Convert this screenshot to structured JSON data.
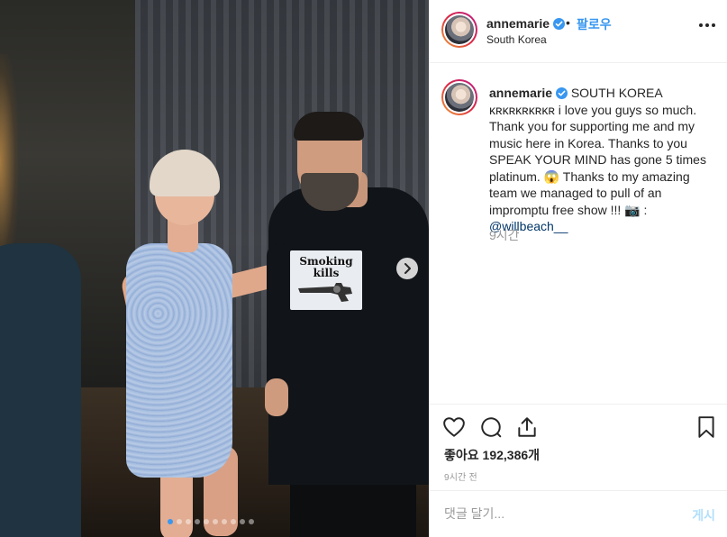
{
  "post": {
    "username": "annemarie",
    "separator": "•",
    "follow_label": "팔로우",
    "location": "South Korea",
    "caption_text": "SOUTH KOREA ᴋʀᴋʀᴋʀᴋʀᴋʀ i love you guys so much. Thank you for supporting me and my music here in Korea. Thanks to you SPEAK YOUR MIND has gone 5 times platinum. 😱 Thanks to my amazing team we managed to pull of an impromptu free show !!! 📷 : ",
    "caption_mention": "@willbeach__",
    "caption_time": "9시간",
    "likes_label": "좋아요",
    "likes_count": "192,386개",
    "posted_ago": "9시간 전",
    "comment_placeholder": "댓글 달기...",
    "post_button": "게시"
  },
  "photo": {
    "shirt_text_line1": "Smoking",
    "shirt_text_line2": "kills",
    "carousel_total": 10,
    "carousel_active": 0
  },
  "icons": {
    "heart": "heart-icon",
    "comment": "comment-icon",
    "share": "share-icon",
    "save": "bookmark-icon",
    "more": "more-options-icon",
    "next": "chevron-right-icon",
    "verified": "verified-badge-icon"
  },
  "colors": {
    "link_blue": "#3897f0",
    "muted_gray": "#999999",
    "text": "#262626"
  }
}
